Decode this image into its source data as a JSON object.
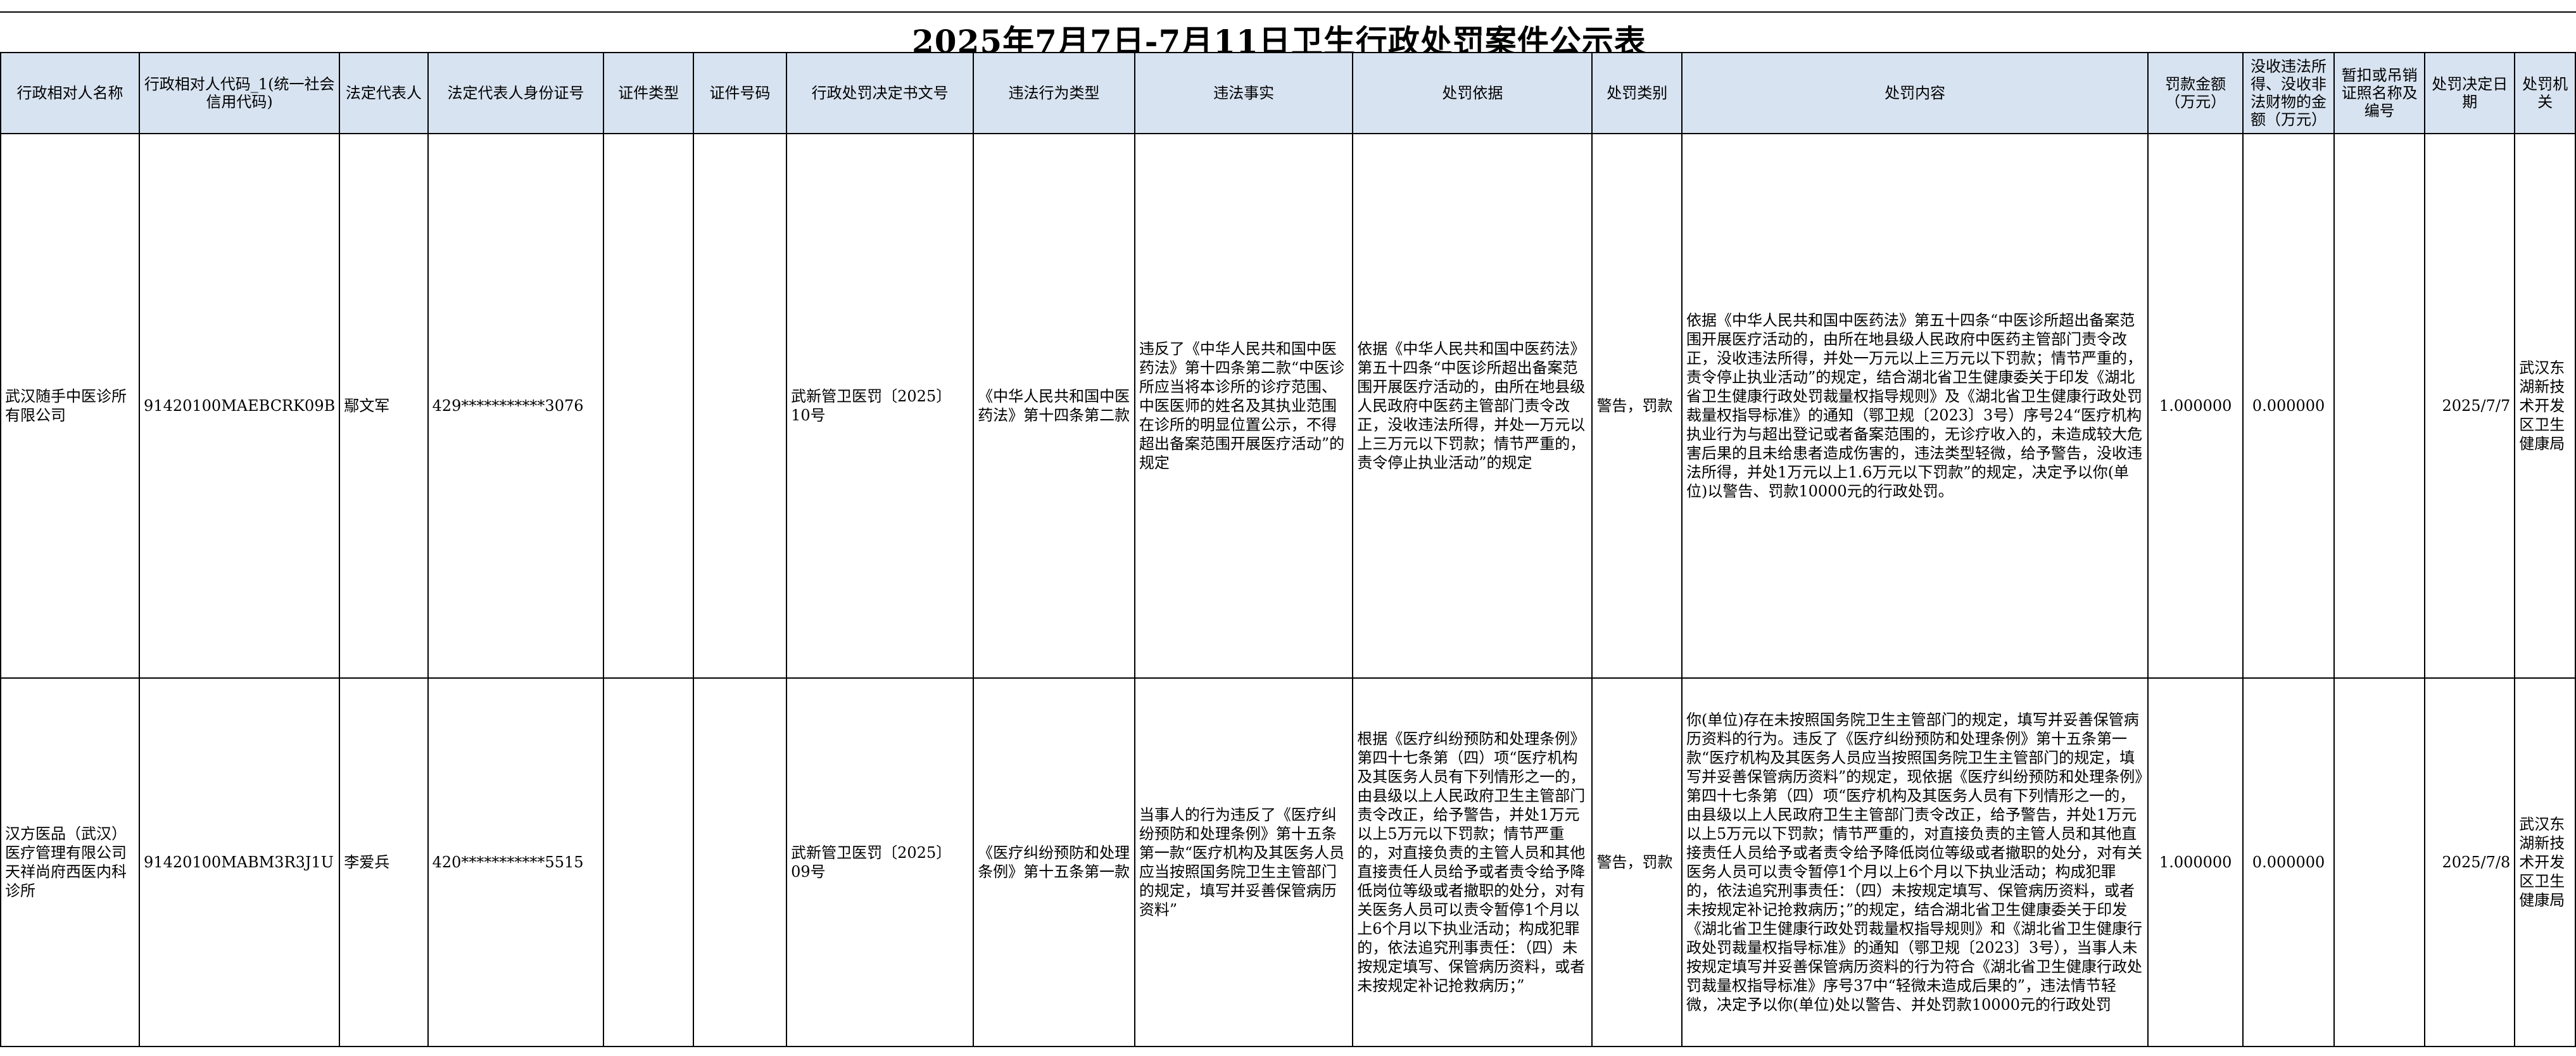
{
  "title": "2025年7月7日-7月11日卫生行政处罚案件公示表",
  "headers": [
    "行政相对人名称",
    "行政相对人代码_1(统一社会信用代码)",
    "法定代表人",
    "法定代表人身份证号",
    "证件类型",
    "证件号码",
    "行政处罚决定书文号",
    "违法行为类型",
    "违法事实",
    "处罚依据",
    "处罚类别",
    "处罚内容",
    "罚款金额（万元）",
    "没收违法所得、没收非法财物的金额（万元）",
    "暂扣或吊销证照名称及编号",
    "处罚决定日期",
    "处罚机关"
  ],
  "rows": [
    {
      "name": "武汉随手中医诊所有限公司",
      "code": "91420100MAEBCRK09B",
      "legal_rep": "鄢文军",
      "id_number": "429***********3076",
      "cert_type": "",
      "cert_number": "",
      "doc_number": "武新管卫医罚〔2025〕10号",
      "violation_type": "《中华人民共和国中医药法》第十四条第二款",
      "facts": "违反了《中华人民共和国中医药法》第十四条第二款“中医诊所应当将本诊所的诊疗范围、中医医师的姓名及其执业范围在诊所的明显位置公示，不得超出备案范围开展医疗活动”的规定",
      "basis": "依据《中华人民共和国中医药法》第五十四条“中医诊所超出备案范围开展医疗活动的，由所在地县级人民政府中医药主管部门责令改正，没收违法所得，并处一万元以上三万元以下罚款；情节严重的，责令停止执业活动”的规定",
      "category": "警告，罚款",
      "content": "依据《中华人民共和国中医药法》第五十四条“中医诊所超出备案范围开展医疗活动的，由所在地县级人民政府中医药主管部门责令改正，没收违法所得，并处一万元以上三万元以下罚款；情节严重的，责令停止执业活动”的规定，结合湖北省卫生健康委关于印发《湖北省卫生健康行政处罚裁量权指导规则》及《湖北省卫生健康行政处罚裁量权指导标准》的通知（鄂卫规〔2023〕3号）序号24“医疗机构执业行为与超出登记或者备案范围的，无诊疗收入的，未造成较大危害后果的且未给患者造成伤害的，违法类型轻微，给予警告，没收违法所得，并处1万元以上1.6万元以下罚款”的规定，决定予以你(单位)以警告、罚款10000元的行政处罚。",
      "fine": "1.000000",
      "confiscation": "0.000000",
      "license": "",
      "date": "2025/7/7",
      "authority": "武汉东湖新技术开发区卫生健康局"
    },
    {
      "name": "汉方医品（武汉）医疗管理有限公司天祥尚府西医内科诊所",
      "code": "91420100MABM3R3J1U",
      "legal_rep": "李爱兵",
      "id_number": "420***********5515",
      "cert_type": "",
      "cert_number": "",
      "doc_number": "武新管卫医罚〔2025〕09号",
      "violation_type": "《医疗纠纷预防和处理条例》第十五条第一款",
      "facts": "当事人的行为违反了《医疗纠纷预防和处理条例》第十五条第一款“医疗机构及其医务人员应当按照国务院卫生主管部门的规定，填写并妥善保管病历资料”",
      "basis": "根据《医疗纠纷预防和处理条例》第四十七条第（四）项“医疗机构及其医务人员有下列情形之一的，由县级以上人民政府卫生主管部门责令改正，给予警告，并处1万元以上5万元以下罚款；情节严重的，对直接负责的主管人员和其他直接责任人员给予或者责令给予降低岗位等级或者撤职的处分，对有关医务人员可以责令暂停1个月以上6个月以下执业活动；构成犯罪的，依法追究刑事责任：（四）未按规定填写、保管病历资料，或者未按规定补记抢救病历；”",
      "category": "警告，罚款",
      "content": "你(单位)存在未按照国务院卫生主管部门的规定，填写并妥善保管病历资料的行为。违反了《医疗纠纷预防和处理条例》第十五条第一款“医疗机构及其医务人员应当按照国务院卫生主管部门的规定，填写并妥善保管病历资料”的规定，现依据《医疗纠纷预防和处理条例》第四十七条第（四）项“医疗机构及其医务人员有下列情形之一的，由县级以上人民政府卫生主管部门责令改正，给予警告，并处1万元以上5万元以下罚款；情节严重的，对直接负责的主管人员和其他直接责任人员给予或者责令给予降低岗位等级或者撤职的处分，对有关医务人员可以责令暂停1个月以上6个月以下执业活动；构成犯罪的，依法追究刑事责任：（四）未按规定填写、保管病历资料，或者未按规定补记抢救病历；”的规定，结合湖北省卫生健康委关于印发《湖北省卫生健康行政处罚裁量权指导规则》和《湖北省卫生健康行政处罚裁量权指导标准》的通知（鄂卫规〔2023〕3号），当事人未按规定填写并妥善保管病历资料的行为符合《湖北省卫生健康行政处罚裁量权指导标准》序号37中“轻微未造成后果的”，违法情节轻微，决定予以你(单位)处以警告、并处罚款10000元的行政处罚",
      "fine": "1.000000",
      "confiscation": "0.000000",
      "license": "",
      "date": "2025/7/8",
      "authority": "武汉东湖新技术开发区卫生健康局"
    }
  ]
}
